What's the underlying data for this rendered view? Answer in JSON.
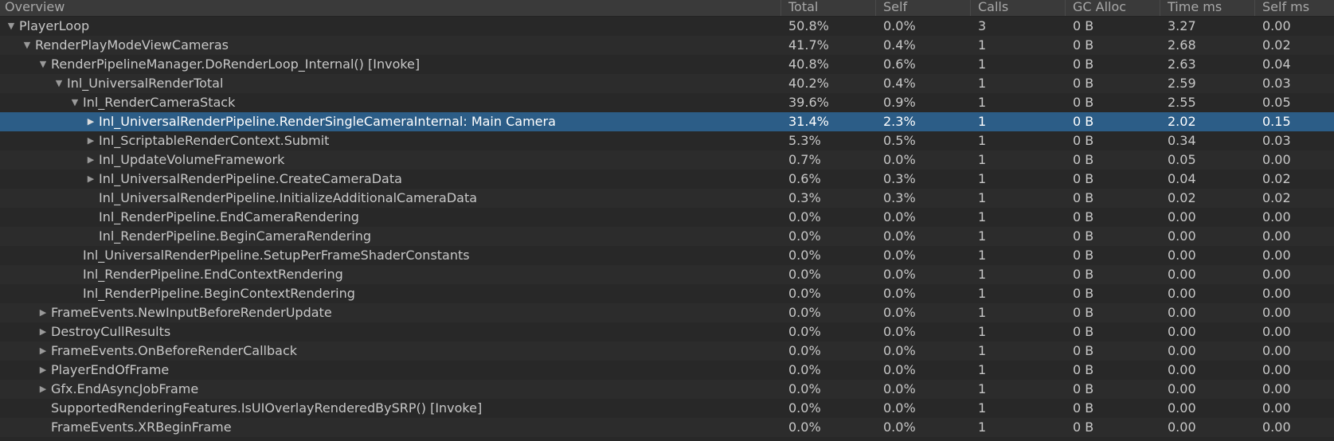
{
  "columns": {
    "overview": "Overview",
    "total": "Total",
    "self": "Self",
    "calls": "Calls",
    "gc_alloc": "GC Alloc",
    "time_ms": "Time ms",
    "self_ms": "Self ms"
  },
  "rows": [
    {
      "name": "PlayerLoop",
      "depth": 0,
      "arrow": "expanded",
      "total": "50.8%",
      "self": "0.0%",
      "calls": "3",
      "gc": "0 B",
      "time": "3.27",
      "selfms": "0.00"
    },
    {
      "name": "RenderPlayModeViewCameras",
      "depth": 1,
      "arrow": "expanded",
      "total": "41.7%",
      "self": "0.4%",
      "calls": "1",
      "gc": "0 B",
      "time": "2.68",
      "selfms": "0.02"
    },
    {
      "name": "RenderPipelineManager.DoRenderLoop_Internal() [Invoke]",
      "depth": 2,
      "arrow": "expanded",
      "total": "40.8%",
      "self": "0.6%",
      "calls": "1",
      "gc": "0 B",
      "time": "2.63",
      "selfms": "0.04"
    },
    {
      "name": "Inl_UniversalRenderTotal",
      "depth": 3,
      "arrow": "expanded",
      "total": "40.2%",
      "self": "0.4%",
      "calls": "1",
      "gc": "0 B",
      "time": "2.59",
      "selfms": "0.03"
    },
    {
      "name": "Inl_RenderCameraStack",
      "depth": 4,
      "arrow": "expanded",
      "total": "39.6%",
      "self": "0.9%",
      "calls": "1",
      "gc": "0 B",
      "time": "2.55",
      "selfms": "0.05"
    },
    {
      "name": "Inl_UniversalRenderPipeline.RenderSingleCameraInternal: Main Camera",
      "depth": 5,
      "arrow": "collapsed",
      "selected": true,
      "total": "31.4%",
      "self": "2.3%",
      "calls": "1",
      "gc": "0 B",
      "time": "2.02",
      "selfms": "0.15"
    },
    {
      "name": "Inl_ScriptableRenderContext.Submit",
      "depth": 5,
      "arrow": "collapsed",
      "total": "5.3%",
      "self": "0.5%",
      "calls": "1",
      "gc": "0 B",
      "time": "0.34",
      "selfms": "0.03"
    },
    {
      "name": "Inl_UpdateVolumeFramework",
      "depth": 5,
      "arrow": "collapsed",
      "total": "0.7%",
      "self": "0.0%",
      "calls": "1",
      "gc": "0 B",
      "time": "0.05",
      "selfms": "0.00"
    },
    {
      "name": "Inl_UniversalRenderPipeline.CreateCameraData",
      "depth": 5,
      "arrow": "collapsed",
      "total": "0.6%",
      "self": "0.3%",
      "calls": "1",
      "gc": "0 B",
      "time": "0.04",
      "selfms": "0.02"
    },
    {
      "name": "Inl_UniversalRenderPipeline.InitializeAdditionalCameraData",
      "depth": 5,
      "arrow": "none",
      "total": "0.3%",
      "self": "0.3%",
      "calls": "1",
      "gc": "0 B",
      "time": "0.02",
      "selfms": "0.02"
    },
    {
      "name": "Inl_RenderPipeline.EndCameraRendering",
      "depth": 5,
      "arrow": "none",
      "total": "0.0%",
      "self": "0.0%",
      "calls": "1",
      "gc": "0 B",
      "time": "0.00",
      "selfms": "0.00"
    },
    {
      "name": "Inl_RenderPipeline.BeginCameraRendering",
      "depth": 5,
      "arrow": "none",
      "total": "0.0%",
      "self": "0.0%",
      "calls": "1",
      "gc": "0 B",
      "time": "0.00",
      "selfms": "0.00"
    },
    {
      "name": "Inl_UniversalRenderPipeline.SetupPerFrameShaderConstants",
      "depth": 4,
      "arrow": "none",
      "total": "0.0%",
      "self": "0.0%",
      "calls": "1",
      "gc": "0 B",
      "time": "0.00",
      "selfms": "0.00"
    },
    {
      "name": "Inl_RenderPipeline.EndContextRendering",
      "depth": 4,
      "arrow": "none",
      "total": "0.0%",
      "self": "0.0%",
      "calls": "1",
      "gc": "0 B",
      "time": "0.00",
      "selfms": "0.00"
    },
    {
      "name": "Inl_RenderPipeline.BeginContextRendering",
      "depth": 4,
      "arrow": "none",
      "total": "0.0%",
      "self": "0.0%",
      "calls": "1",
      "gc": "0 B",
      "time": "0.00",
      "selfms": "0.00"
    },
    {
      "name": "FrameEvents.NewInputBeforeRenderUpdate",
      "depth": 2,
      "arrow": "collapsed",
      "total": "0.0%",
      "self": "0.0%",
      "calls": "1",
      "gc": "0 B",
      "time": "0.00",
      "selfms": "0.00"
    },
    {
      "name": "DestroyCullResults",
      "depth": 2,
      "arrow": "collapsed",
      "total": "0.0%",
      "self": "0.0%",
      "calls": "1",
      "gc": "0 B",
      "time": "0.00",
      "selfms": "0.00"
    },
    {
      "name": "FrameEvents.OnBeforeRenderCallback",
      "depth": 2,
      "arrow": "collapsed",
      "total": "0.0%",
      "self": "0.0%",
      "calls": "1",
      "gc": "0 B",
      "time": "0.00",
      "selfms": "0.00"
    },
    {
      "name": "PlayerEndOfFrame",
      "depth": 2,
      "arrow": "collapsed",
      "total": "0.0%",
      "self": "0.0%",
      "calls": "1",
      "gc": "0 B",
      "time": "0.00",
      "selfms": "0.00"
    },
    {
      "name": "Gfx.EndAsyncJobFrame",
      "depth": 2,
      "arrow": "collapsed",
      "total": "0.0%",
      "self": "0.0%",
      "calls": "1",
      "gc": "0 B",
      "time": "0.00",
      "selfms": "0.00"
    },
    {
      "name": "SupportedRenderingFeatures.IsUIOverlayRenderedBySRP() [Invoke]",
      "depth": 2,
      "arrow": "none",
      "total": "0.0%",
      "self": "0.0%",
      "calls": "1",
      "gc": "0 B",
      "time": "0.00",
      "selfms": "0.00"
    },
    {
      "name": "FrameEvents.XRBeginFrame",
      "depth": 2,
      "arrow": "none",
      "total": "0.0%",
      "self": "0.0%",
      "calls": "1",
      "gc": "0 B",
      "time": "0.00",
      "selfms": "0.00"
    }
  ],
  "icons": {
    "expanded": "triangle-down-icon",
    "collapsed": "triangle-right-icon"
  },
  "colors": {
    "selection": "#2c5d87",
    "background": "#282828",
    "header": "#3a3a3a"
  }
}
